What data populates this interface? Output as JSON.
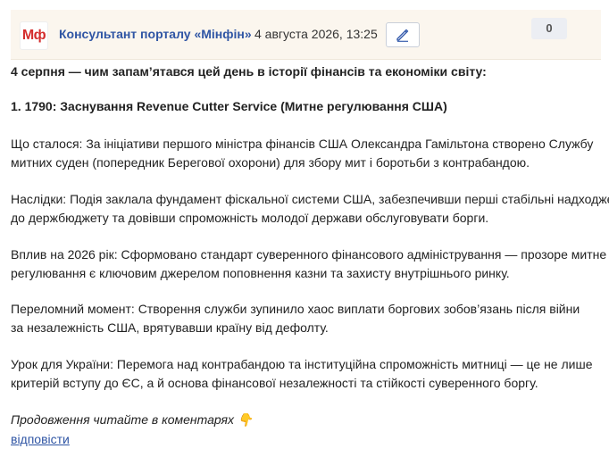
{
  "header": {
    "logo_text": "Мф",
    "author": "Консультант порталу «Мінфін»",
    "date": "4 августа 2026, 13:25",
    "edit_icon": "pencil-icon",
    "counter": "0"
  },
  "post": {
    "intro": "4 серпня — чим запам’ятався цей день в історії фінансів та економіки світу:",
    "heading": "1. 1790: Заснування Revenue Cutter Service (Митне регулювання США)",
    "what": {
      "line1": "Що сталося: За ініціативи першого міністра фінансів США Олександра Гамільтона створено Службу",
      "line2": "митних суден (попередник Берегової охорони) для збору мит і боротьби з контрабандою."
    },
    "consequences": {
      "line1": "Наслідки: Подія заклала фундамент фіскальної системи США, забезпечивши перші стабільні надходження",
      "line2": "до держбюджету та довівши спроможність молодої держави обслуговувати борги."
    },
    "impact": {
      "line1": "Вплив на 2026 рік: Сформовано стандарт суверенного фінансового адміністрування — прозоре митне",
      "line2": "регулювання є ключовим джерелом поповнення казни та захисту внутрішнього ринку."
    },
    "turning": {
      "line1": "Переломний момент: Створення служби зупинило хаос виплати боргових зобов’язань після війни",
      "line2": "за незалежність США, врятувавши країну від дефолту."
    },
    "lesson": {
      "line1": "Урок для України: Перемога над контрабандою та інституційна спроможність митниці — це не лише",
      "line2": "критерій вступу до ЄС, а й основа фінансової незалежності та стійкості суверенного боргу."
    },
    "continue": "Продовження читайте в коментарях 👇"
  },
  "actions": {
    "reply": "відповісти"
  },
  "colors": {
    "header_bg": "#fbf6ee",
    "link": "#2f55a4",
    "logo_red": "#d42d2d"
  }
}
